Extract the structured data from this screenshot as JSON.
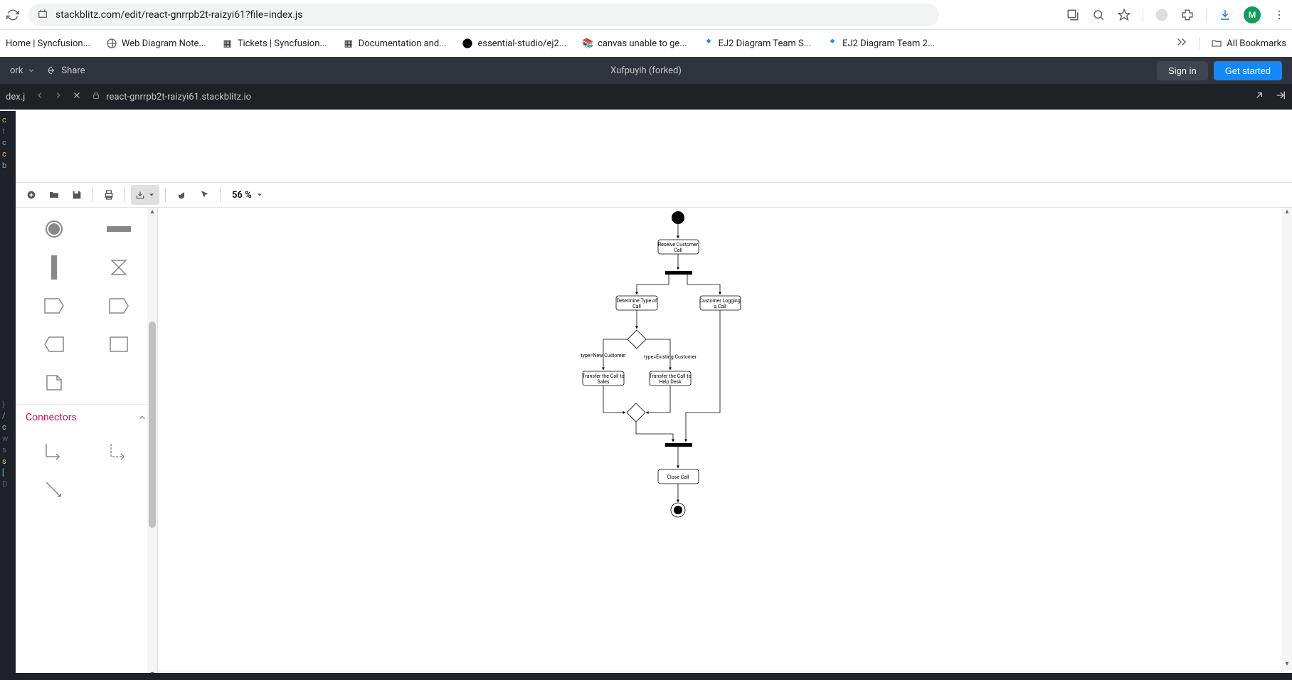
{
  "browser": {
    "url": "stackblitz.com/edit/react-gnrrpb2t-raizyi61?file=index.js",
    "avatar_letter": "M"
  },
  "bookmarks": {
    "items": [
      "Home | Syncfusion...",
      "Web Diagram Note...",
      "Tickets | Syncfusion...",
      "Documentation and...",
      "essential-studio/ej2...",
      "canvas unable to ge...",
      "EJ2 Diagram Team S...",
      "EJ2 Diagram Team 2..."
    ],
    "all_bookmarks_label": "All Bookmarks"
  },
  "stackblitz": {
    "fork_label": "ork",
    "share_label": "Share",
    "project_title": "Xufpuyih (forked)",
    "signin_label": "Sign in",
    "getstarted_label": "Get started"
  },
  "preview": {
    "tab_label": "dex.j",
    "url_text": "react-gnrrpb2t-raizyi61.stackblitz.io"
  },
  "toolbar": {
    "zoom_text": "56 %"
  },
  "palette": {
    "connectors_label": "Connectors"
  },
  "diagram": {
    "nodes": {
      "receive": "Receive Customer Call",
      "receive_l1": "Receive Customer",
      "receive_l2": "Call",
      "determine": "Determine Type of Call",
      "determine_l1": "Determine Type of",
      "determine_l2": "Call",
      "logging": "Customer Logging a Call",
      "logging_l1": "Customer Logging",
      "logging_l2": "a Call",
      "label_new": "type=New Customer",
      "label_existing": "type=Existing Customer",
      "transfer_sales": "Transfer the Call to Sales",
      "transfer_sales_l1": "Transfer the Call to",
      "transfer_sales_l2": "Sales",
      "transfer_help": "Transfer the Call to Help Desk",
      "transfer_help_l1": "Transfer the Call to",
      "transfer_help_l2": "Help Desk",
      "close": "Close Call"
    }
  }
}
